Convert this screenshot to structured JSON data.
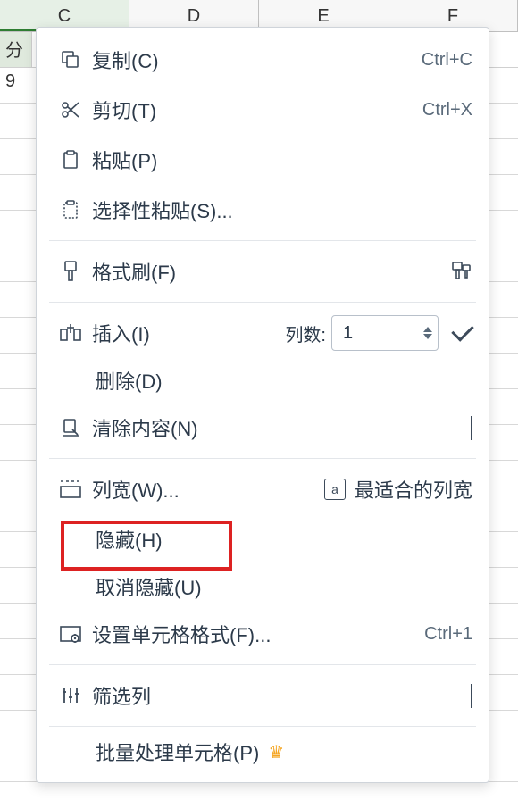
{
  "columns": [
    "C",
    "D",
    "E",
    "F"
  ],
  "first_row": {
    "cell_a": "分",
    "cell_b": "9"
  },
  "menu": {
    "copy": {
      "label": "复制(C)",
      "shortcut": "Ctrl+C"
    },
    "cut": {
      "label": "剪切(T)",
      "shortcut": "Ctrl+X"
    },
    "paste": {
      "label": "粘贴(P)"
    },
    "paste_special": {
      "label": "选择性粘贴(S)..."
    },
    "format_painter": {
      "label": "格式刷(F)"
    },
    "insert": {
      "label": "插入(I)",
      "count_label": "列数:",
      "count_value": "1"
    },
    "delete": {
      "label": "删除(D)"
    },
    "clear": {
      "label": "清除内容(N)"
    },
    "col_width": {
      "label": "列宽(W)...",
      "autofit_label": "最适合的列宽",
      "autofit_icon_letter": "a"
    },
    "hide": {
      "label": "隐藏(H)"
    },
    "unhide": {
      "label": "取消隐藏(U)"
    },
    "format_cells": {
      "label": "设置单元格格式(F)...",
      "shortcut": "Ctrl+1"
    },
    "filter_col": {
      "label": "筛选列"
    },
    "batch": {
      "label": "批量处理单元格(P)"
    }
  }
}
